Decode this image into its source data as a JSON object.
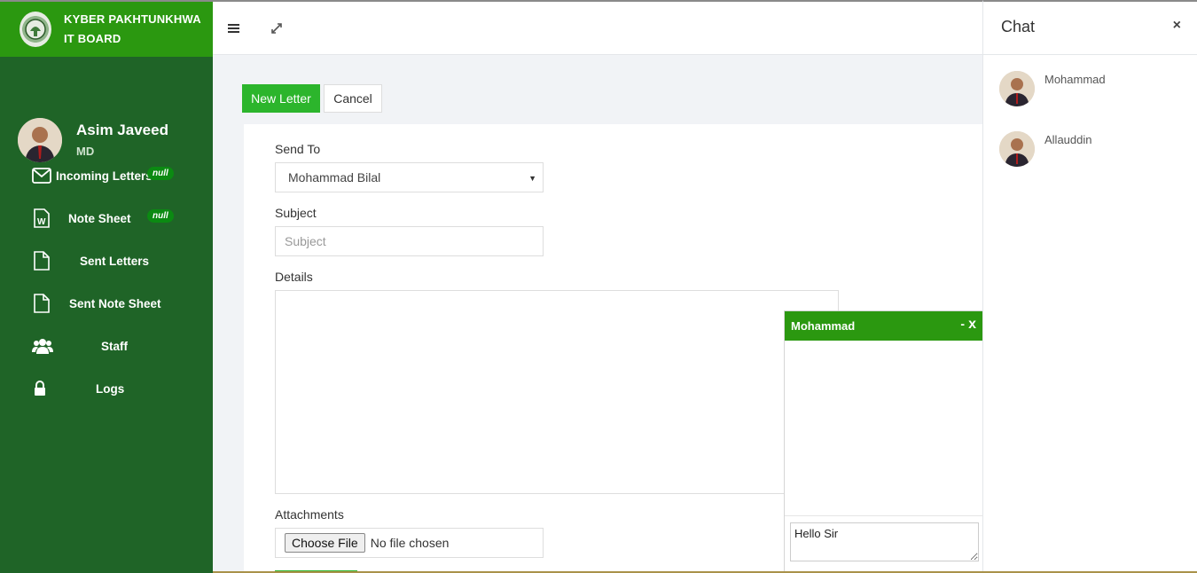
{
  "brand": {
    "line1": "KYBER PAKHTUNKHWA",
    "line2": "IT BOARD",
    "icon": "emblem-logo"
  },
  "user": {
    "name": "Asim Javeed",
    "role": "MD"
  },
  "nav": [
    {
      "label": "Incoming Letters",
      "icon": "envelope-icon",
      "badge": "null"
    },
    {
      "label": "Note Sheet",
      "icon": "word-document-icon",
      "badge": "null"
    },
    {
      "label": "Sent Letters",
      "icon": "file-icon"
    },
    {
      "label": "Sent Note Sheet",
      "icon": "file-icon"
    },
    {
      "label": "Staff",
      "icon": "users-icon"
    },
    {
      "label": "Logs",
      "icon": "lock-icon"
    }
  ],
  "topbar": {
    "menu_icon": "hamburger-icon",
    "fullscreen_icon": "expand-icon"
  },
  "actions": {
    "new_letter": "New Letter",
    "cancel": "Cancel"
  },
  "form": {
    "send_to_label": "Send To",
    "send_to_value": "Mohammad Bilal",
    "subject_label": "Subject",
    "subject_placeholder": "Subject",
    "details_label": "Details",
    "details_value": "",
    "attachments_label": "Attachments",
    "choose_file": "Choose File",
    "no_file": "No file chosen"
  },
  "chatbox": {
    "title": "Mohammad",
    "minimize": "-",
    "close": "x",
    "message": "Hello Sir"
  },
  "chatpanel": {
    "title": "Chat",
    "close": "×",
    "contacts": [
      {
        "name": "Mohammad"
      },
      {
        "name": "Allauddin"
      }
    ]
  },
  "colors": {
    "sidebar": "#1f6427",
    "brand": "#2b9810",
    "primary_button": "#2cb52c",
    "badge": "#0b8a12"
  }
}
